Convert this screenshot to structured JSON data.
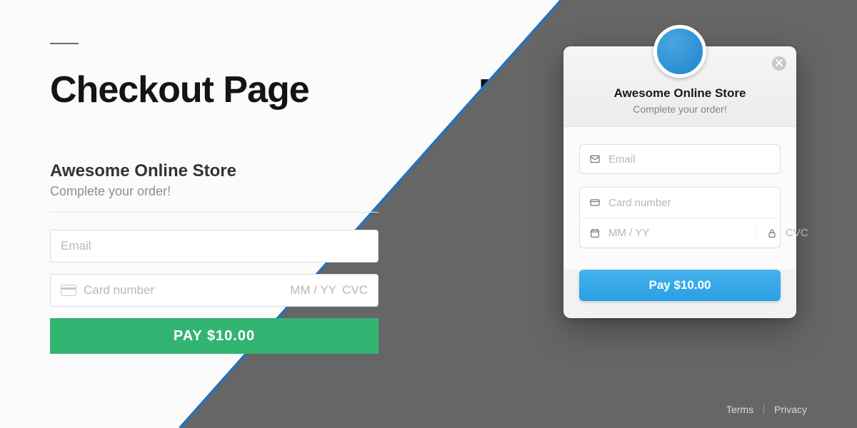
{
  "left": {
    "headline": "Checkout Page",
    "store_name": "Awesome Online Store",
    "subtitle": "Complete your order!",
    "email_placeholder": "Email",
    "card_placeholder": "Card number",
    "exp_placeholder": "MM / YY",
    "cvc_placeholder": "CVC",
    "pay_label": "PAY $10.00"
  },
  "ghost_title": "Page",
  "modal": {
    "store_name": "Awesome Online Store",
    "subtitle": "Complete your order!",
    "email_placeholder": "Email",
    "card_placeholder": "Card number",
    "exp_placeholder": "MM / YY",
    "cvc_placeholder": "CVC",
    "pay_label": "Pay $10.00"
  },
  "footer": {
    "terms": "Terms",
    "privacy": "Privacy"
  },
  "colors": {
    "accent_green": "#32b473",
    "accent_blue": "#2a9fe4",
    "diagonal_stroke": "#2a71b5"
  }
}
